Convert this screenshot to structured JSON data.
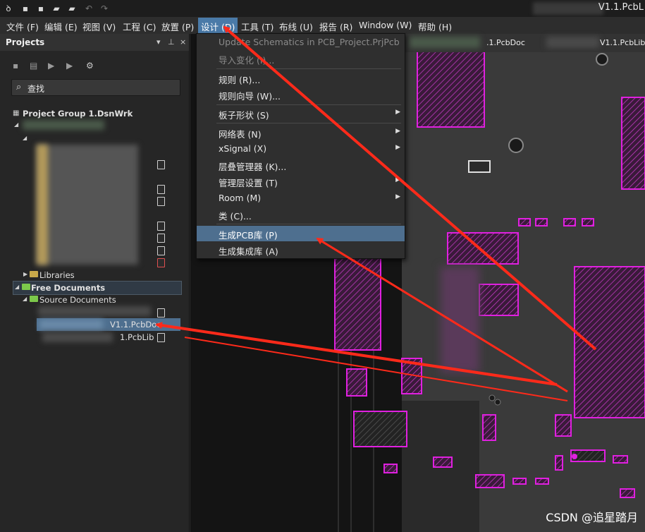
{
  "titlebar": {
    "title_suffix": "V1.1.PcbL"
  },
  "menubar": {
    "items": [
      {
        "label": "文件 (F)"
      },
      {
        "label": "编辑 (E)"
      },
      {
        "label": "视图 (V)"
      },
      {
        "label": "工程 (C)"
      },
      {
        "label": "放置 (P)"
      },
      {
        "label": "设计 (D)"
      },
      {
        "label": "工具 (T)"
      },
      {
        "label": "布线 (U)"
      },
      {
        "label": "报告 (R)"
      },
      {
        "label": "Window (W)"
      },
      {
        "label": "帮助 (H)"
      }
    ]
  },
  "projects_panel": {
    "title": "Projects",
    "search_placeholder": "查找",
    "project_group": "Project Group 1.DsnWrk",
    "libraries": "Libraries",
    "free_documents": "Free Documents",
    "source_documents": "Source Documents",
    "pcbdoc_file": "V1.1.PcbDoc",
    "pcblib_file": "1.PcbLib"
  },
  "doc_tabs": {
    "pcbdoc": ".1.PcbDoc",
    "pcblib": "V1.1.PcbLib"
  },
  "design_menu": {
    "items": [
      {
        "label": "Update Schematics in PCB_Project.PrjPcb",
        "disabled": true
      },
      {
        "label": "导入变化 (I)...",
        "disabled": true
      },
      {
        "label": "规则 (R)..."
      },
      {
        "label": "规则向导 (W)..."
      },
      {
        "label": "板子形状 (S)",
        "submenu": true
      },
      {
        "label": "网络表 (N)",
        "submenu": true
      },
      {
        "label": "xSignal (X)",
        "submenu": true
      },
      {
        "label": "层叠管理器 (K)..."
      },
      {
        "label": "管理层设置 (T)",
        "submenu": true
      },
      {
        "label": "Room (M)",
        "submenu": true
      },
      {
        "label": "类 (C)..."
      },
      {
        "label": "生成PCB库 (P)",
        "highlighted": true
      },
      {
        "label": "生成集成库 (A)"
      }
    ]
  },
  "watermark": "CSDN @追星踏月",
  "colors": {
    "accent": "#4e6f8f",
    "arrow": "#ff2a1a",
    "pcb_magenta": "#e020e0"
  }
}
